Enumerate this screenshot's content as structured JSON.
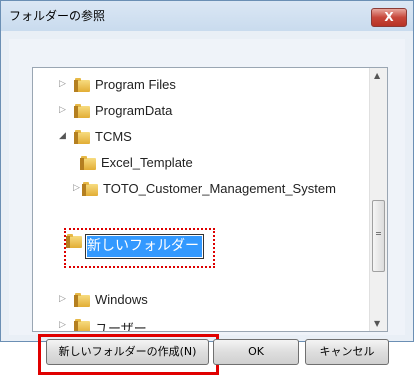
{
  "dialog": {
    "title": "フォルダーの参照",
    "close": "X"
  },
  "tree": {
    "items": [
      {
        "label": "Program Files"
      },
      {
        "label": "ProgramData"
      },
      {
        "label": "TCMS"
      },
      {
        "label": "Excel_Template"
      },
      {
        "label": "TOTO_Customer_Management_System"
      },
      {
        "label": "新しいフォルダー"
      },
      {
        "label": "Windows"
      },
      {
        "label": "ユーザー"
      }
    ]
  },
  "buttons": {
    "new_folder": "新しいフォルダーの作成(N)",
    "ok": "OK",
    "cancel": "キャンセル"
  }
}
